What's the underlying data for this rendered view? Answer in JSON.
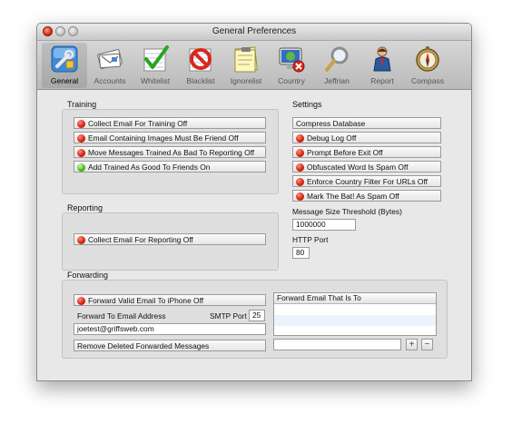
{
  "window": {
    "title": "General Preferences"
  },
  "toolbar": {
    "items": [
      {
        "label": "General"
      },
      {
        "label": "Accounts"
      },
      {
        "label": "Whitelist"
      },
      {
        "label": "Blacklist"
      },
      {
        "label": "Ignorelist"
      },
      {
        "label": "Country"
      },
      {
        "label": "Jeffrian"
      },
      {
        "label": "Report"
      },
      {
        "label": "Compass"
      }
    ],
    "selected": "General"
  },
  "training": {
    "title": "Training",
    "items": [
      {
        "label": "Collect Email For Training Off",
        "status": "red"
      },
      {
        "label": "Email Containing Images Must Be Friend Off",
        "status": "red"
      },
      {
        "label": "Move Messages Trained As Bad To Reporting Off",
        "status": "red"
      },
      {
        "label": "Add Trained As Good To Friends On",
        "status": "green"
      }
    ]
  },
  "reporting": {
    "title": "Reporting",
    "items": [
      {
        "label": "Collect Email For Reporting Off",
        "status": "red"
      }
    ]
  },
  "settings": {
    "title": "Settings",
    "compress_label": "Compress Database",
    "items": [
      {
        "label": "Debug Log Off",
        "status": "red"
      },
      {
        "label": "Prompt Before Exit Off",
        "status": "red"
      },
      {
        "label": "Obfuscated Word Is Spam Off",
        "status": "red"
      },
      {
        "label": "Enforce Country Filter For URLs Off",
        "status": "red"
      },
      {
        "label": "Mark The Bat! As Spam Off",
        "status": "red"
      }
    ],
    "size_threshold_label": "Message Size Threshold (Bytes)",
    "size_threshold_value": "1000000",
    "http_port_label": "HTTP Port",
    "http_port_value": "80"
  },
  "forwarding": {
    "title": "Forwarding",
    "forward_valid": {
      "label": "Forward Valid Email To iPhone Off",
      "status": "red"
    },
    "address_label": "Forward To Email Address",
    "smtp_label": "SMTP Port",
    "smtp_value": "25",
    "address_value": "joetest@griffsweb.com",
    "remove_label": "Remove Deleted Forwarded Messages",
    "table_header": "Forward Email That Is To",
    "add_label": "+",
    "remove_btn_label": "−",
    "new_entry_value": ""
  },
  "colors": {
    "status_red": "#d22010",
    "status_green": "#45b620"
  }
}
